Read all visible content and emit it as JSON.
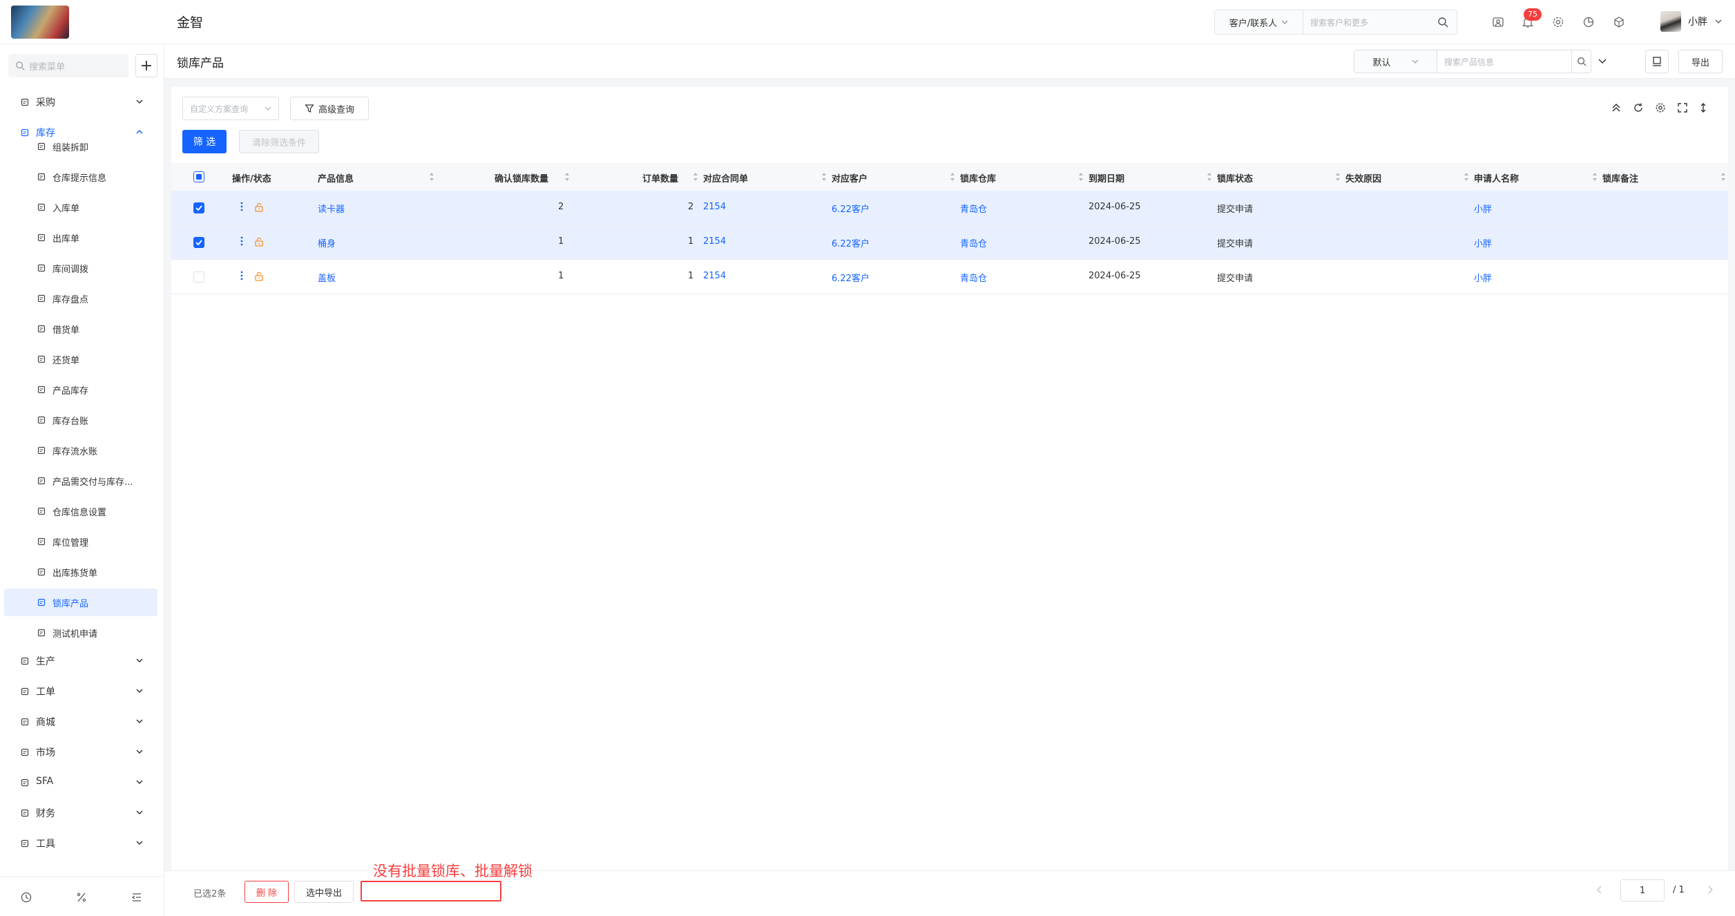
{
  "app": {
    "name": "金智"
  },
  "topbar": {
    "customer_select": "客户/联系人",
    "customer_search_placeholder": "搜索客户和更多",
    "notification_count": "75",
    "user_name": "小胖"
  },
  "sidebar": {
    "search_placeholder": "搜索菜单",
    "groups_top": [
      {
        "label": "采购",
        "icon": "cart-icon"
      },
      {
        "label": "库存",
        "icon": "warehouse-icon"
      }
    ],
    "inventory_items": [
      {
        "label": "组装拆卸",
        "icon": "copy-icon"
      },
      {
        "label": "仓库提示信息",
        "icon": "list-icon"
      },
      {
        "label": "入库单",
        "icon": "inbox-icon"
      },
      {
        "label": "出库单",
        "icon": "outbox-icon"
      },
      {
        "label": "库间调拨",
        "icon": "transfer-icon"
      },
      {
        "label": "库存盘点",
        "icon": "calendar-icon"
      },
      {
        "label": "借货单",
        "icon": "borrow-icon"
      },
      {
        "label": "还货单",
        "icon": "return-icon"
      },
      {
        "label": "产品库存",
        "icon": "doc-icon"
      },
      {
        "label": "库存台账",
        "icon": "ledger-icon"
      },
      {
        "label": "库存流水账",
        "icon": "flow-icon"
      },
      {
        "label": "产品需交付与库存...",
        "icon": "columns-icon"
      },
      {
        "label": "仓库信息设置",
        "icon": "gear-icon"
      },
      {
        "label": "库位管理",
        "icon": "shelf-icon"
      },
      {
        "label": "出库拣货单",
        "icon": "pick-icon"
      },
      {
        "label": "锁库产品",
        "icon": "lock-doc-icon"
      },
      {
        "label": "测试机申请",
        "icon": "test-icon"
      }
    ],
    "groups_bottom": [
      {
        "label": "生产",
        "icon": "factory-icon"
      },
      {
        "label": "工单",
        "icon": "ticket-icon"
      },
      {
        "label": "商城",
        "icon": "shop-icon"
      },
      {
        "label": "市场",
        "icon": "market-icon"
      },
      {
        "label": "SFA",
        "icon": "sfa-icon"
      },
      {
        "label": "财务",
        "icon": "finance-icon"
      },
      {
        "label": "工具",
        "icon": "tools-icon"
      }
    ]
  },
  "page": {
    "title": "锁库产品",
    "view_select": "默认",
    "search_placeholder": "搜索产品信息",
    "export_label": "导出"
  },
  "toolbar": {
    "scheme_placeholder": "自定义方案查询",
    "advanced_label": "高级查询",
    "filter_label": "筛 选",
    "clear_label": "清除筛选条件"
  },
  "table": {
    "columns": [
      "操作/状态",
      "产品信息",
      "确认锁库数量",
      "订单数量",
      "对应合同单",
      "对应客户",
      "锁库仓库",
      "到期日期",
      "锁库状态",
      "失效原因",
      "申请人名称",
      "锁库备注"
    ],
    "rows": [
      {
        "selected": true,
        "product": "读卡器",
        "confirm_qty": "2",
        "order_qty": "2",
        "contract": "2154",
        "customer": "6.22客户",
        "warehouse": "青岛仓",
        "due_date": "2024-06-25",
        "status": "提交申请",
        "reason": "",
        "applicant": "小胖",
        "remark": ""
      },
      {
        "selected": true,
        "product": "桶身",
        "confirm_qty": "1",
        "order_qty": "1",
        "contract": "2154",
        "customer": "6.22客户",
        "warehouse": "青岛仓",
        "due_date": "2024-06-25",
        "status": "提交申请",
        "reason": "",
        "applicant": "小胖",
        "remark": ""
      },
      {
        "selected": false,
        "product": "盖板",
        "confirm_qty": "1",
        "order_qty": "1",
        "contract": "2154",
        "customer": "6.22客户",
        "warehouse": "青岛仓",
        "due_date": "2024-06-25",
        "status": "提交申请",
        "reason": "",
        "applicant": "小胖",
        "remark": ""
      }
    ]
  },
  "footer": {
    "selected_text": "已选2条",
    "delete_label": "删 除",
    "selected_export_label": "选中导出",
    "annotation": "没有批量锁库、批量解锁",
    "page_current": "1",
    "page_total": "/ 1"
  },
  "colors": {
    "accent": "#1664ff",
    "danger": "#f53f3f",
    "lock": "#f5922b"
  }
}
